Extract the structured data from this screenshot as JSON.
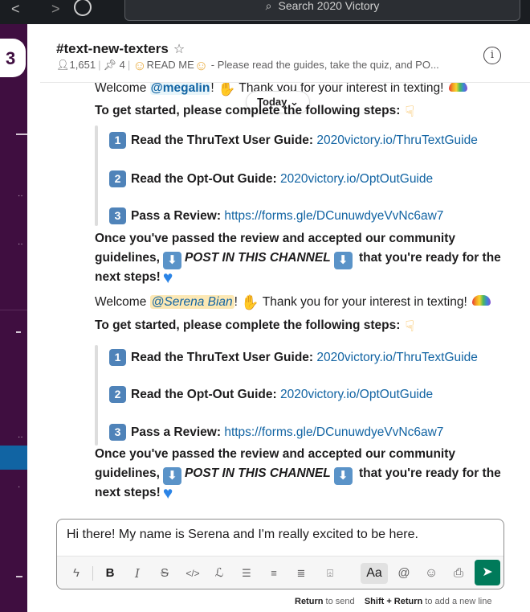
{
  "search": {
    "placeholder": "Search 2020 Victory"
  },
  "workspace": {
    "initial": "3"
  },
  "channel": {
    "name": "#text-new-texters",
    "members": "1,651",
    "pinned": "4",
    "topic": "READ ME",
    "description": " - Please read the guides, take the quiz, and PO..."
  },
  "divider": {
    "label": "Today"
  },
  "message1": {
    "welcome": "Welcome ",
    "mention": "@megalin",
    "thanks_cut": " Thank you for your interest in texting!",
    "steps_intro": "To get started, please complete the following steps:",
    "step1_label": "Read the ThruText User Guide: ",
    "step1_link": "2020victory.io/ThruTextGuide",
    "step2_label": "Read the Opt-Out Guide: ",
    "step2_link": "2020victory.io/OptOutGuide",
    "step3_label": "Pass a Review: ",
    "step3_link": "https://forms.gle/DCunuwdyeVvNc6aw7",
    "outro1": "Once you've passed the review and accepted our community",
    "outro2a": "guidelines,",
    "outro2b": "POST IN THIS CHANNEL",
    "outro2c": "that you're ready for the",
    "outro3": "next steps!"
  },
  "message2": {
    "welcome": "Welcome ",
    "mention": "@Serena Bian",
    "thanks": " Thank you for your interest in texting!",
    "steps_intro": "To get started, please complete the following steps:",
    "step1_label": "Read the ThruText User Guide: ",
    "step1_link": "2020victory.io/ThruTextGuide",
    "step2_label": "Read the Opt-Out Guide: ",
    "step2_link": "2020victory.io/OptOutGuide",
    "step3_label": "Pass a Review: ",
    "step3_link": "https://forms.gle/DCunuwdyeVvNc6aw7",
    "outro1": "Once you've passed the review and accepted our community",
    "outro2a": "guidelines,",
    "outro2b": "POST IN THIS CHANNEL",
    "outro2c": "that you're ready for the",
    "outro3": "next steps!"
  },
  "composer": {
    "value": "Hi there! My name is Serena and I'm really excited to be here.",
    "aa_label": "Aa"
  },
  "hint": {
    "key1": "Return",
    "text1": " to send",
    "key2": "Shift + Return",
    "text2": " to add a new line"
  },
  "colors": {
    "sidebar": "#3f0e40",
    "active": "#1164a3",
    "link": "#1264a3",
    "send": "#007a5a"
  }
}
